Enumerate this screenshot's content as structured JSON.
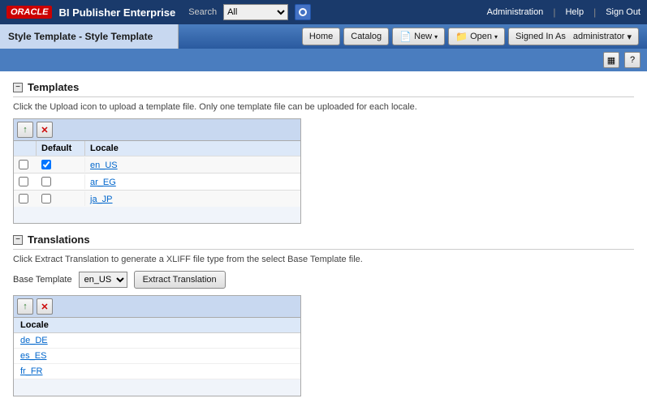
{
  "app": {
    "logo": "ORACLE",
    "title": "BI Publisher Enterprise",
    "search_label": "Search",
    "search_option": "All"
  },
  "top_nav": {
    "administration": "Administration",
    "help": "Help",
    "sign_out": "Sign Out"
  },
  "page": {
    "title": "Style Template - Style Template"
  },
  "nav_buttons": {
    "home": "Home",
    "catalog": "Catalog",
    "new": "New",
    "open": "Open",
    "signed_in_as": "Signed In As",
    "username": "administrator"
  },
  "sections": {
    "templates": {
      "title": "Templates",
      "description": "Click the Upload icon to upload a template file. Only one template file can be uploaded for each locale.",
      "columns": {
        "default": "Default",
        "locale": "Locale"
      },
      "rows": [
        {
          "locale": "en_US",
          "checked": true
        },
        {
          "locale": "ar_EG",
          "checked": false
        },
        {
          "locale": "ja_JP",
          "checked": false
        }
      ]
    },
    "translations": {
      "title": "Translations",
      "description": "Click Extract Translation to generate a XLIFF file type from the select Base Template file.",
      "base_template_label": "Base Template",
      "base_template_value": "en_US",
      "extract_btn": "Extract Translation",
      "column_locale": "Locale",
      "rows": [
        {
          "locale": "de_DE"
        },
        {
          "locale": "es_ES"
        },
        {
          "locale": "fr_FR"
        }
      ]
    }
  },
  "icons": {
    "upload": "↑",
    "delete": "✕",
    "layout": "▦",
    "question": "?",
    "minus": "−",
    "arrow_down": "▾"
  }
}
